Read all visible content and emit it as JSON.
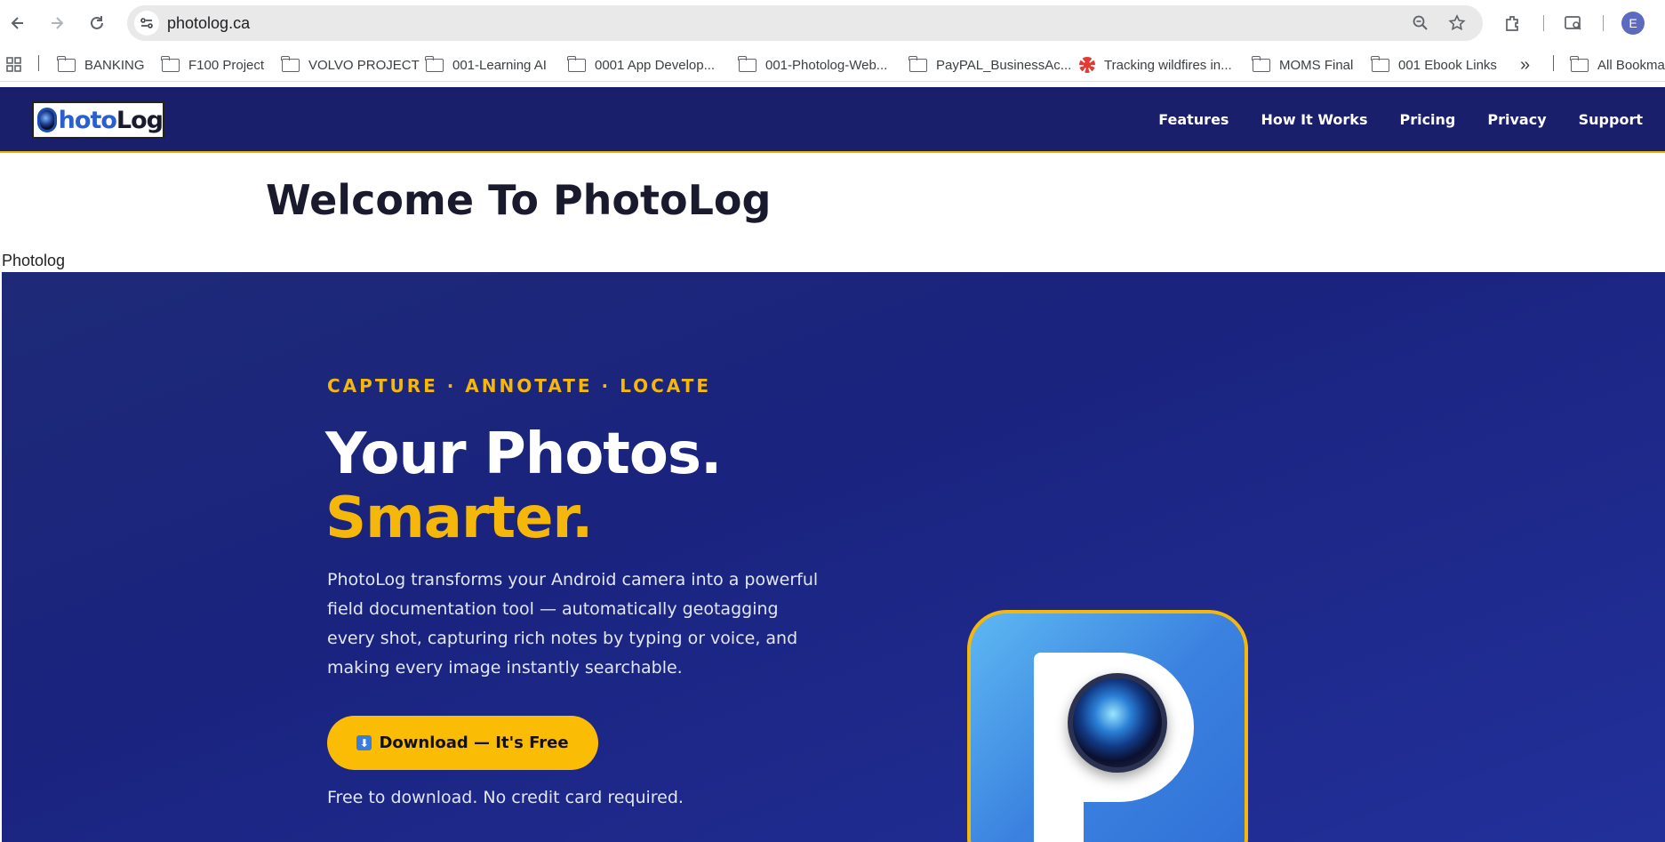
{
  "browser": {
    "url": "photolog.ca",
    "avatar_initial": "E",
    "bookmarks": [
      {
        "label": "BANKING",
        "icon": "folder-icon"
      },
      {
        "label": "F100 Project",
        "icon": "folder-icon"
      },
      {
        "label": "VOLVO PROJECT",
        "icon": "folder-icon"
      },
      {
        "label": "001-Learning AI",
        "icon": "folder-icon"
      },
      {
        "label": "0001 App Develop...",
        "icon": "folder-icon"
      },
      {
        "label": "001-Photolog-Web...",
        "icon": "folder-icon"
      },
      {
        "label": "PayPAL_BusinessAc...",
        "icon": "folder-icon"
      },
      {
        "label": "Tracking wildfires in...",
        "icon": "cbc-icon"
      },
      {
        "label": "MOMS Final",
        "icon": "folder-icon"
      },
      {
        "label": "001 Ebook Links",
        "icon": "folder-icon"
      }
    ],
    "overflow_label": "»",
    "all_bookmarks_label": "All Bookma"
  },
  "site": {
    "logo_text_a": "hoto",
    "logo_text_b": "Log",
    "nav": [
      "Features",
      "How It Works",
      "Pricing",
      "Privacy",
      "Support"
    ],
    "welcome": "Welcome To PhotoLog",
    "image_alt_text": "Photolog"
  },
  "hero": {
    "eyebrow": "CAPTURE · ANNOTATE · LOCATE",
    "headline_1": "Your Photos.",
    "headline_2": "Smarter.",
    "description": "PhotoLog transforms your Android camera into a powerful field documentation tool — automatically geotagging every shot, capturing rich notes by typing or voice, and making every image instantly searchable.",
    "cta_label": "Download — It's Free",
    "cta_icon": "download-arrow-icon",
    "note": "Free to download. No credit card required."
  },
  "colors": {
    "header_bg": "#1a1f6c",
    "hero_bg": "#1e2a78",
    "accent": "#f5b80a",
    "cta": "#fbbc05"
  }
}
